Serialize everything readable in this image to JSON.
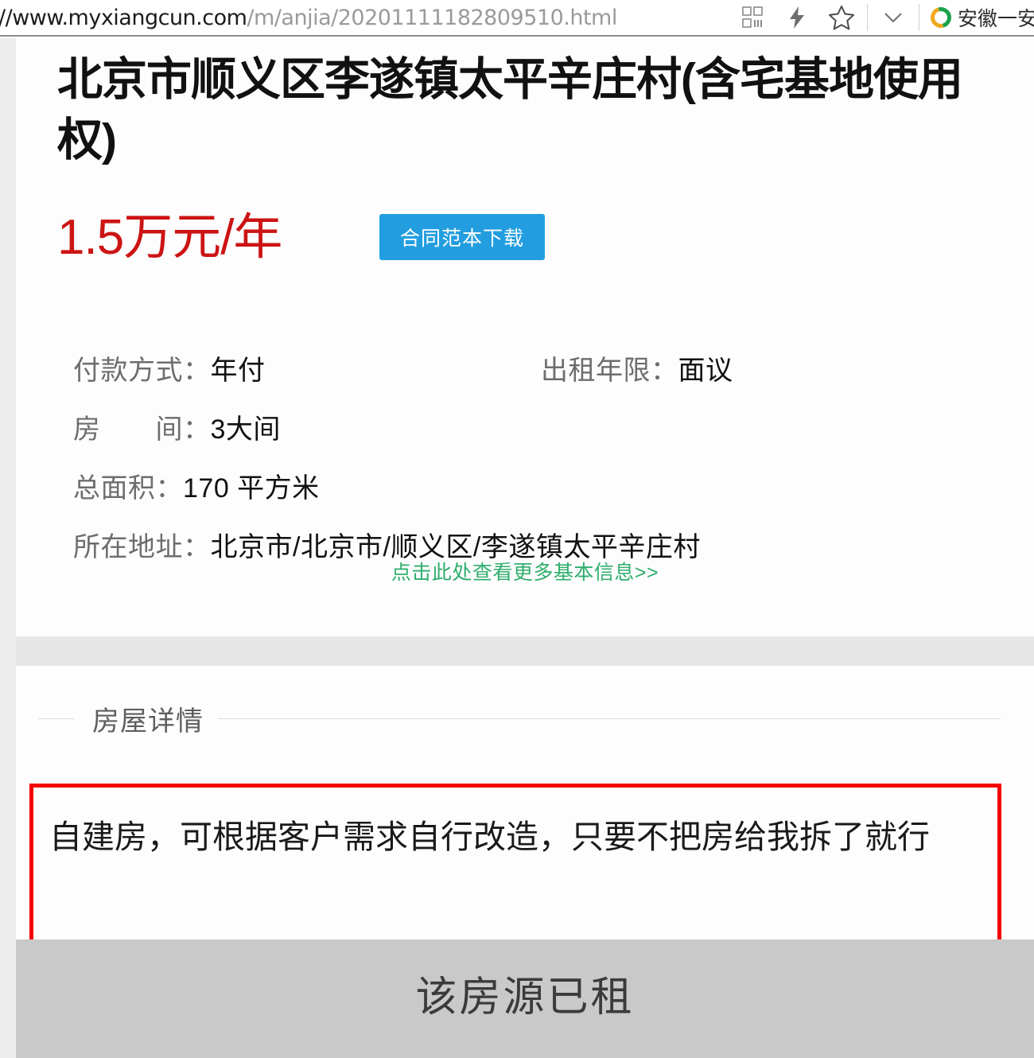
{
  "browser": {
    "url_host": "//www.myxiangcun.com",
    "url_path": "/m/anjia/20201111182809510.html",
    "icons": {
      "qr": "qr-code-icon",
      "lightning": "lightning-bolt-icon",
      "star": "star-bookmark-icon",
      "chevron": "chevron-down-icon"
    },
    "tab": {
      "title": "安徽一安",
      "favicon": "circle-logo-icon"
    }
  },
  "listing": {
    "title": "北京市顺义区李遂镇太平辛庄村(含宅基地使用权)",
    "price": "1.5万元/年",
    "contract_button": "合同范本下载",
    "specs": [
      {
        "label": "付款方式：",
        "value": "年付"
      },
      {
        "label": "出租年限：",
        "value": "面议"
      },
      {
        "label": "房　　间：",
        "value": "3大间"
      },
      {
        "label": "总面积：",
        "value": "170 平方米"
      },
      {
        "label": "所在地址：",
        "value": "北京市/北京市/顺义区/李遂镇太平辛庄村"
      }
    ],
    "more_info_link": "点击此处查看更多基本信息>>"
  },
  "detail": {
    "section_title": "房屋详情",
    "description": "自建房，可根据客户需求自行改造，只要不把房给我拆了就行"
  },
  "status": {
    "rented_banner": "该房源已租"
  },
  "colors": {
    "price_red": "#cc1414",
    "button_blue": "#229ee0",
    "link_green": "#2fae6d",
    "highlight_border_red": "#f40000",
    "banner_gray": "#c9c9c9"
  }
}
